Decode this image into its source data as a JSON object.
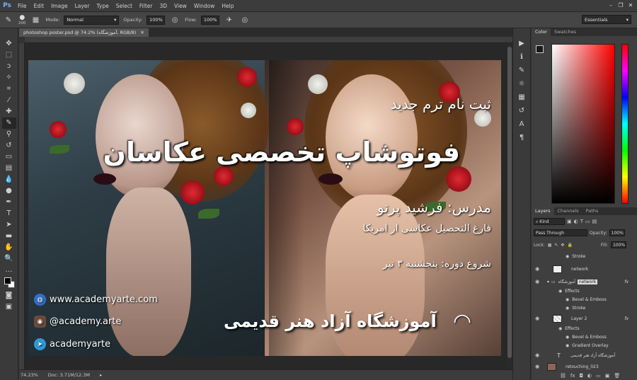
{
  "app": {
    "logo": "Ps"
  },
  "menu": [
    "File",
    "Edit",
    "Image",
    "Layer",
    "Type",
    "Select",
    "Filter",
    "3D",
    "View",
    "Window",
    "Help"
  ],
  "options": {
    "brush_size": "200",
    "mode_label": "Mode:",
    "mode_value": "Normal",
    "opacity_label": "Opacity:",
    "opacity_value": "100%",
    "flow_label": "Flow:",
    "flow_value": "100%",
    "workspace": "Essentials"
  },
  "document": {
    "tab_title": "photoshop poster.psd @ 74.2% (آموزشگاه, RGB/8)",
    "zoom": "74.23%",
    "doc_size": "Doc: 3.71M/12.3M"
  },
  "poster": {
    "line1": "ثبت نام ترم جدید",
    "title": "فوتوشاپ تخصصی عکاسان",
    "teacher": "مدرس: فرشید پرتو",
    "degree": "فارغ التحصیل عکاسی از امریکا",
    "start": "شروع دوره: پنجشنبه ۳ تیر",
    "website": "www.academyarte.com",
    "instagram": "@academy.arte",
    "telegram": "academyarte",
    "academy": "آموزشگاه آزاد هنر قدیمی"
  },
  "panels": {
    "color_tab": "Color",
    "swatches_tab": "Swatches",
    "layers_tab": "Layers",
    "channels_tab": "Channels",
    "paths_tab": "Paths",
    "kind": "Kind",
    "blend": "Pass Through",
    "opacity_label": "Opacity:",
    "opacity": "100%",
    "lock_label": "Lock:",
    "fill_label": "Fill:",
    "fill": "100%"
  },
  "layers": [
    {
      "name": "Stroke",
      "kind": "effect"
    },
    {
      "name": "network",
      "kind": "layer"
    },
    {
      "name": "آموزشگاه",
      "tag": "network",
      "kind": "group"
    },
    {
      "name": "Effects",
      "kind": "effects-header"
    },
    {
      "name": "Bevel & Emboss",
      "kind": "effect"
    },
    {
      "name": "Stroke",
      "kind": "effect"
    },
    {
      "name": "Layer 2",
      "kind": "layer"
    },
    {
      "name": "Effects",
      "kind": "effects-header"
    },
    {
      "name": "Bevel & Emboss",
      "kind": "effect"
    },
    {
      "name": "Gradient Overlay",
      "kind": "effect"
    },
    {
      "name": "آموزشگاه آزاد هنر قدیمی",
      "kind": "text"
    },
    {
      "name": "retouching_023",
      "kind": "layer"
    }
  ],
  "colors": {
    "ps_blue": "#6fb4ff",
    "panel_bg": "#3f3f3f",
    "menu_bg": "#3c3c3c"
  }
}
